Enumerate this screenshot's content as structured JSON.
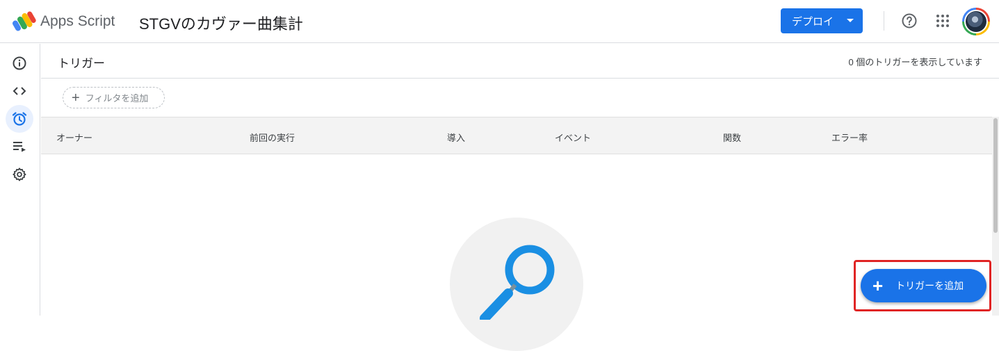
{
  "header": {
    "app_name": "Apps Script",
    "project_title": "STGVのカヴァー曲集計",
    "deploy_label": "デプロイ",
    "icons": [
      "apps-script-logo",
      "help-icon",
      "apps-grid-icon",
      "avatar"
    ]
  },
  "sidebar": {
    "items": [
      {
        "name": "overview",
        "icon": "info-icon"
      },
      {
        "name": "editor",
        "icon": "code-icon"
      },
      {
        "name": "triggers",
        "icon": "alarm-clock-icon",
        "active": true
      },
      {
        "name": "executions",
        "icon": "executions-icon"
      },
      {
        "name": "settings",
        "icon": "gear-icon"
      }
    ]
  },
  "main": {
    "title": "トリガー",
    "count_text": "0 個のトリガーを表示しています",
    "filter_label": "フィルタを追加",
    "columns": [
      "オーナー",
      "前回の実行",
      "導入",
      "イベント",
      "関数",
      "エラー率"
    ],
    "add_trigger_label": "トリガーを追加"
  },
  "colors": {
    "accent": "#1a73e8",
    "highlight": "#e02424",
    "empty_state_icon": "#1a8fe3"
  }
}
